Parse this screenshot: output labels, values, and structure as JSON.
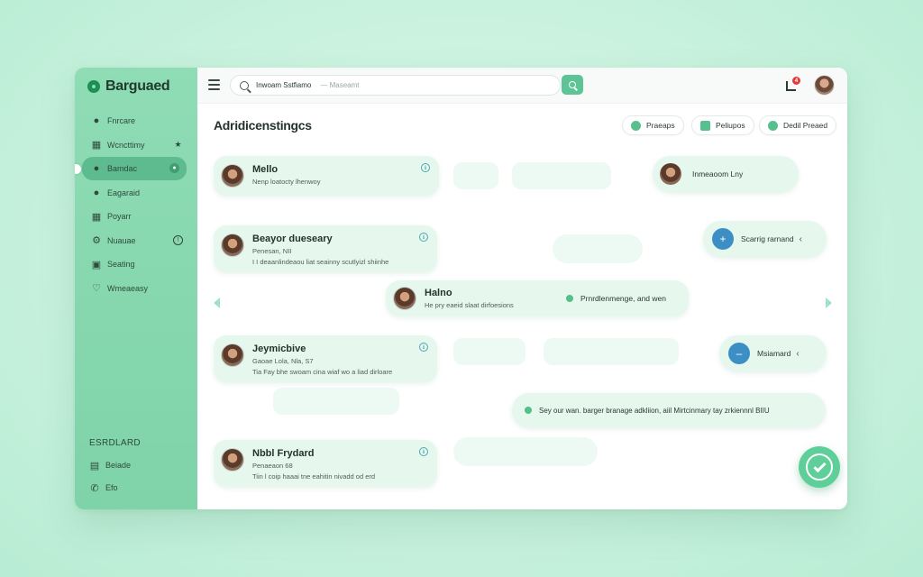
{
  "app": {
    "brand": "Barguaed"
  },
  "sidebar": {
    "items": [
      {
        "label": "Fnrcare",
        "icon": "user-icon"
      },
      {
        "label": "Wcncttimy",
        "icon": "team-icon",
        "badge": "★"
      },
      {
        "label": "Bamdac",
        "icon": "user-icon",
        "active": true,
        "badge": "●"
      },
      {
        "label": "Eagaraid",
        "icon": "user-icon"
      },
      {
        "label": "Poyarr",
        "icon": "grid-icon"
      },
      {
        "label": "Nuauae",
        "icon": "gear-icon",
        "badge": "!"
      },
      {
        "label": "Seating",
        "icon": "image-icon"
      },
      {
        "label": "Wmeaeasy",
        "icon": "heart-icon"
      }
    ],
    "section_title": "ESRDLARD",
    "sub_items": [
      {
        "label": "Beiade",
        "icon": "doc-icon"
      },
      {
        "label": "Efo",
        "icon": "phone-icon"
      }
    ]
  },
  "topbar": {
    "search_value": "Inwoam Sstfiamo",
    "search_placeholder": "— Maseamt",
    "notif_count": "4"
  },
  "main": {
    "title": "Adridicenstingcs",
    "pill_buttons": [
      {
        "label": "Praeaps",
        "icon": "globe-icon"
      },
      {
        "label": "Peliupos",
        "icon": "chat-icon"
      },
      {
        "label": "Dedil Preaed",
        "icon": "pin-icon"
      }
    ],
    "cards": [
      {
        "name": "Mello",
        "line1": "Nenp loatocty lhenwoy",
        "line2": ""
      },
      {
        "name": "Beayor dueseary",
        "line1": "Penesan, NII",
        "line2": "I I deaanlindeaou liat seainny scutlyizl shiinhe"
      },
      {
        "name": "Halno",
        "line1": "He pry eaeid slaat dirfoesions",
        "line2": ""
      },
      {
        "name": "Jeymicbive",
        "line1": "Gaoae Lola, Nla, S7",
        "line2": "Tia Fay bhe swoam cina wiaf wo a liad dirloare"
      },
      {
        "name": "Nbbl Frydard",
        "line1": "Penaeaon 68",
        "line2": "Tiin l coip haaai tne eahitin nivadd od erd"
      }
    ],
    "halno_status": "Prnrdlenmenge, and wen",
    "right_bubbles": [
      {
        "text": "Inmeaoom Lny"
      },
      {
        "text": "Scarrig rarnand"
      },
      {
        "text": "Msiamard"
      },
      {
        "text": "Sey our wan. barger branage adkliion, aiil Mirtcinmary tay zrkiennnl BIIU"
      }
    ]
  },
  "colors": {
    "accent": "#5dc495",
    "sidebar": "#8fdcb5",
    "bubble": "#e6f7ee"
  }
}
